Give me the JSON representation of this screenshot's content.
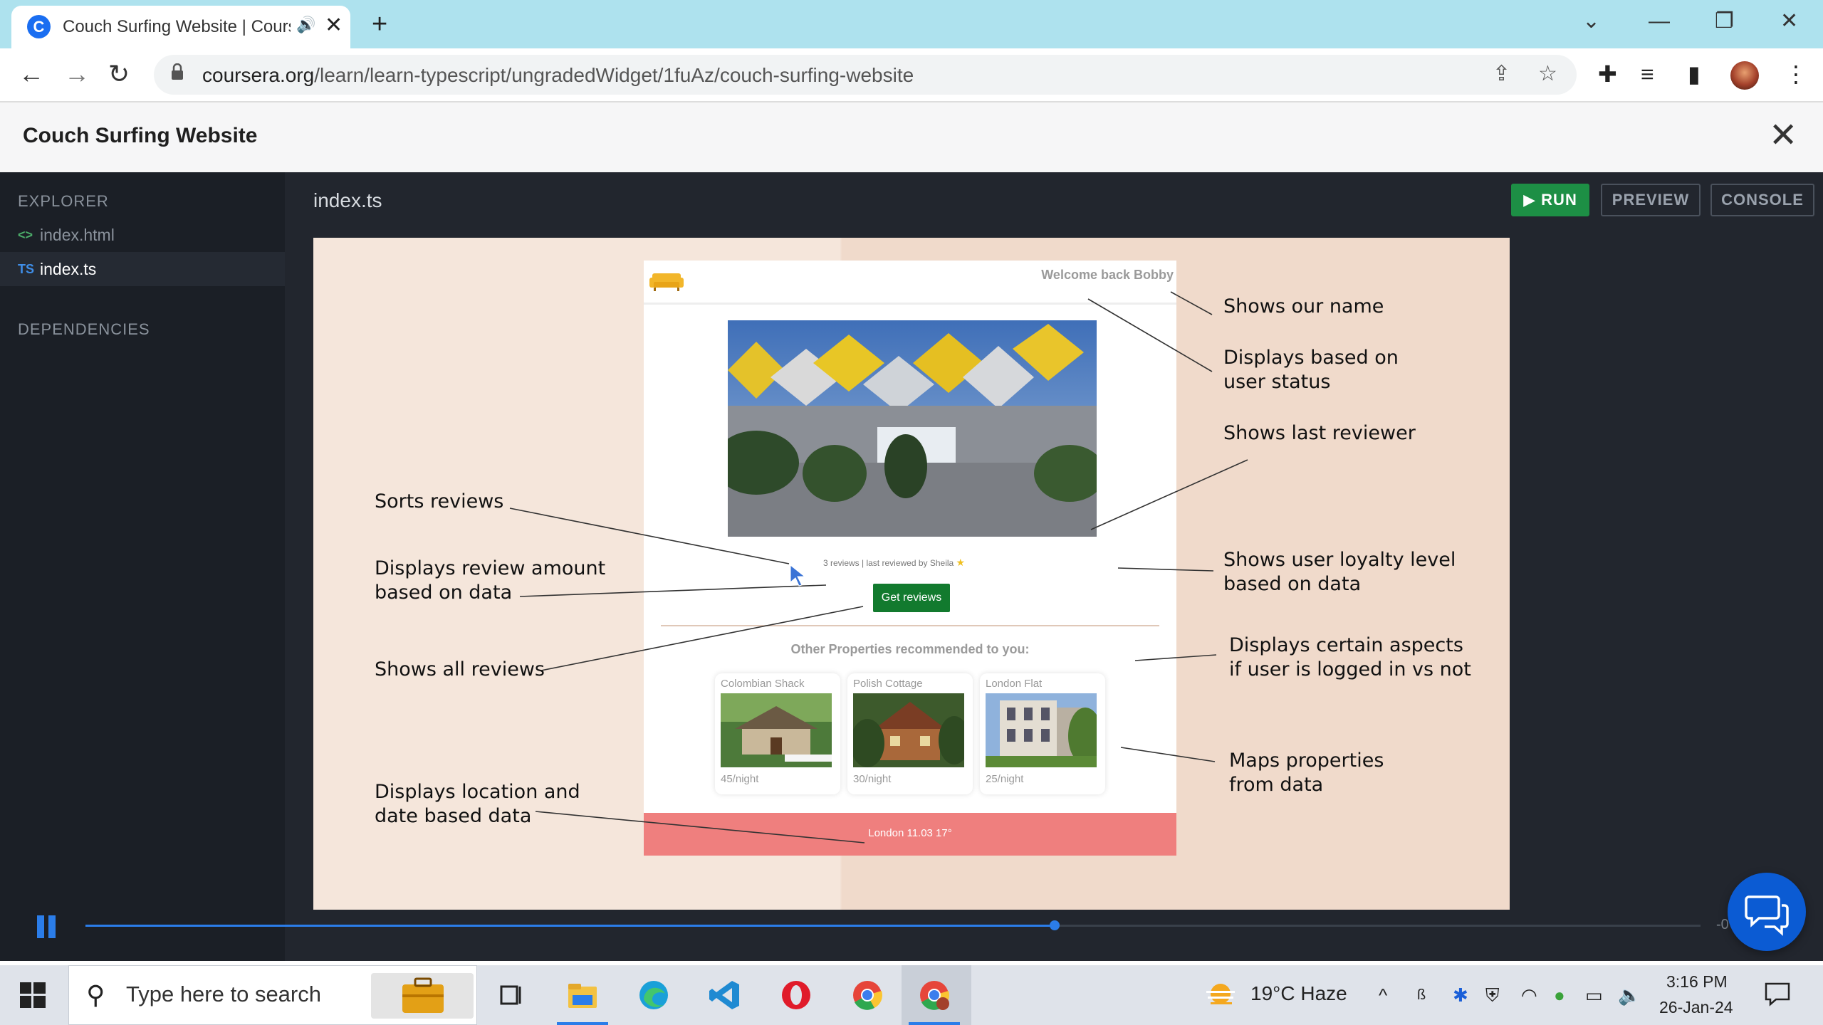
{
  "browser": {
    "tab_title": "Couch Surfing Website | Coursera",
    "favicon_letter": "C",
    "url_host": "coursera.org",
    "url_path": "/learn/learn-typescript/ungradedWidget/1fuAz/couch-surfing-website",
    "icons": [
      "back-arrow-icon",
      "forward-arrow-icon",
      "reload-icon",
      "lock-icon",
      "share-icon",
      "star-icon",
      "extensions-icon",
      "media-control-icon",
      "side-panel-icon",
      "kebab-menu-icon"
    ]
  },
  "lab": {
    "title": "Couch Surfing Website"
  },
  "sidebar": {
    "explorer_heading": "EXPLORER",
    "files": [
      {
        "badge": "<>",
        "name": "index.html"
      },
      {
        "badge": "TS",
        "name": "index.ts"
      }
    ],
    "dependencies_heading": "DEPENDENCIES"
  },
  "editor": {
    "tab_name": "index.ts",
    "run_label": "▶ RUN",
    "preview_label": "PREVIEW",
    "console_label": "CONSOLE"
  },
  "slide": {
    "welcome_text": "Welcome back Bobby",
    "reviews_text": "3 reviews | last reviewed by Sheila",
    "get_reviews_label": "Get reviews",
    "other_title": "Other Properties recommended to you:",
    "properties": [
      {
        "name": "Colombian Shack",
        "price": "45/night"
      },
      {
        "name": "Polish Cottage",
        "price": "30/night"
      },
      {
        "name": "London Flat",
        "price": "25/night"
      }
    ],
    "footer_text": "London 11.03 17°",
    "annotations": {
      "name": "Shows our name",
      "status_1": "Displays based on",
      "status_2": "user status",
      "reviewer": "Shows last reviewer",
      "sorts": "Sorts reviews",
      "amount_1": "Displays review amount",
      "amount_2": "based on data",
      "loyalty_1": "Shows user loyalty level",
      "loyalty_2": "based on data",
      "all_reviews": "Shows all reviews",
      "aspects_1": "Displays certain aspects",
      "aspects_2": "if user is logged in vs not",
      "maps_1": "Maps properties",
      "maps_2": "from data",
      "location_1": "Displays location and",
      "location_2": "date based data"
    },
    "colors": {
      "footer": "#ef7f7e",
      "button": "#127a2e",
      "background": "#f5e6db"
    }
  },
  "video": {
    "progress": 0.6,
    "time_remaining": "-0"
  },
  "taskbar": {
    "search_placeholder": "Type here to search",
    "weather": "19°C  Haze",
    "time": "3:16 PM",
    "date": "26-Jan-24",
    "apps": [
      "task-view-icon",
      "file-explorer-icon",
      "edge-icon",
      "vscode-icon",
      "opera-icon",
      "chrome-icon",
      "chrome-profile-icon"
    ]
  }
}
